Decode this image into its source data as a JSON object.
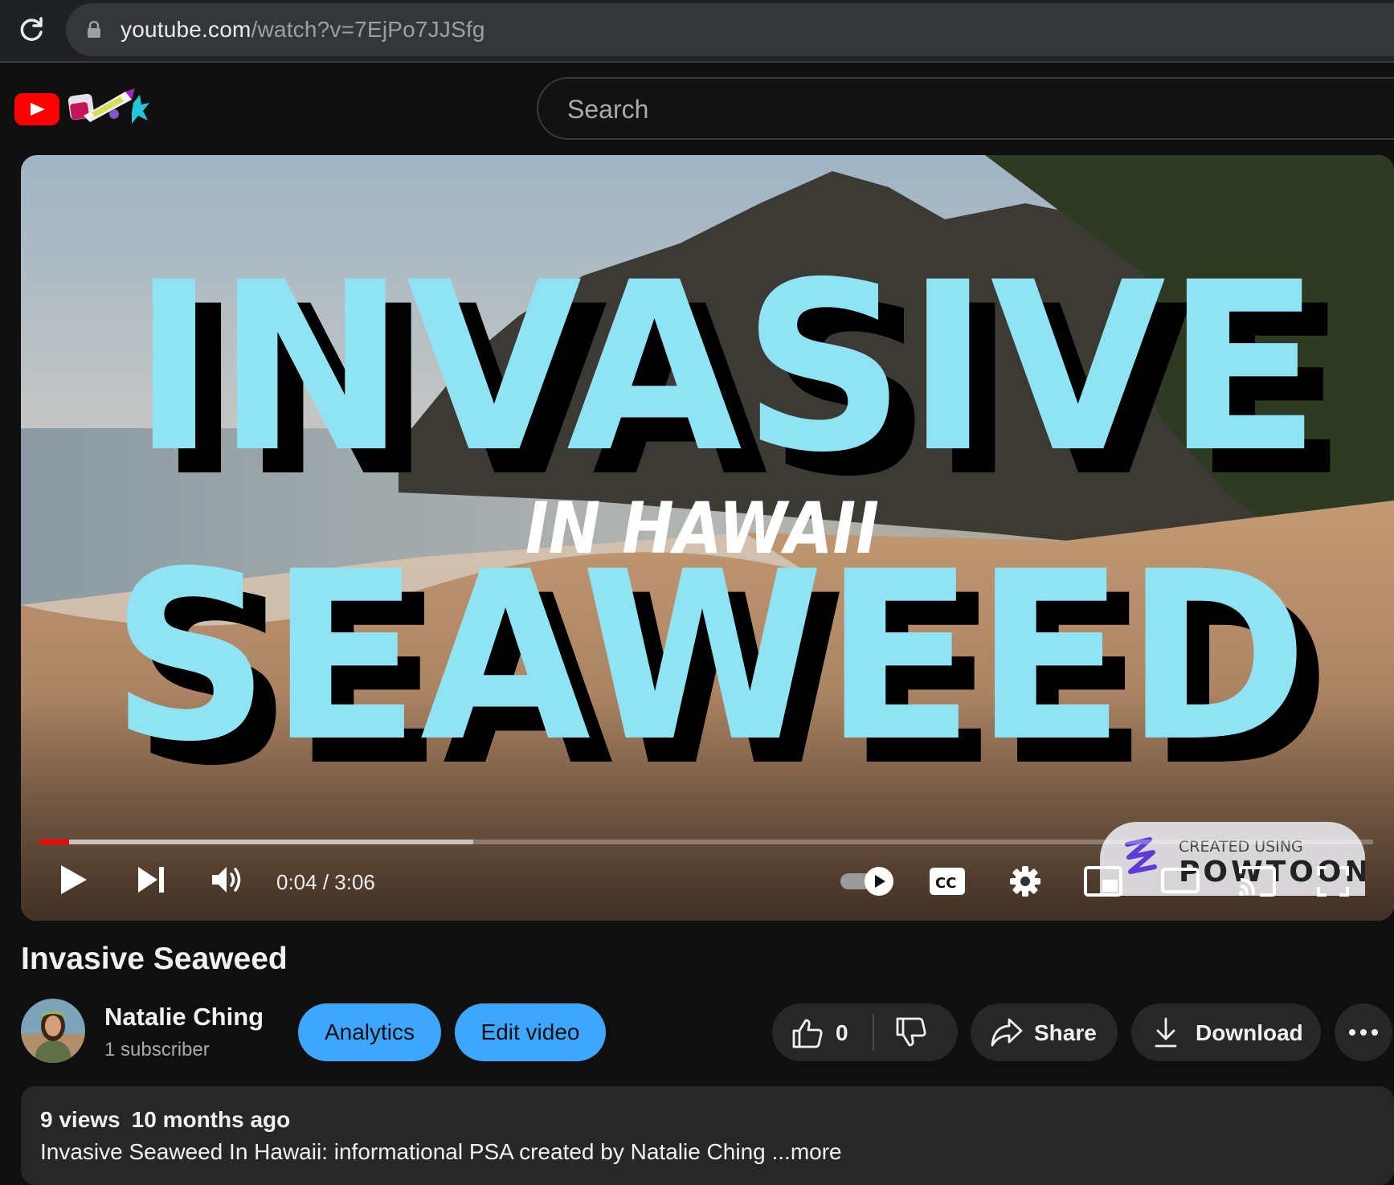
{
  "browser": {
    "url_host": "youtube.com",
    "url_path": "/watch?v=7EjPo7JJSfg"
  },
  "masthead": {
    "search_placeholder": "Search"
  },
  "player": {
    "overlay_line1": "INVASIVE",
    "overlay_line2": "IN HAWAII",
    "overlay_line3": "SEAWEED",
    "watermark_top": "CREATED USING",
    "watermark_brand": "POWTOON",
    "time_display": "0:04 / 3:06",
    "played_fraction": 0.022,
    "buffered_fraction": 0.325,
    "autoplay_on": true
  },
  "video": {
    "title": "Invasive Seaweed"
  },
  "channel": {
    "name": "Natalie Ching",
    "subscribers": "1 subscriber"
  },
  "actions": {
    "analytics": "Analytics",
    "edit_video": "Edit video",
    "like_count": "0",
    "share": "Share",
    "download": "Download"
  },
  "description": {
    "views": "9 views",
    "age": "10 months ago",
    "text": "Invasive Seaweed In Hawaii: informational PSA created by Natalie Ching",
    "more": "...more"
  },
  "colors": {
    "accent_blue": "#3ea6ff",
    "progress_red": "#ff0000",
    "title_cyan": "#8fe3f2"
  }
}
